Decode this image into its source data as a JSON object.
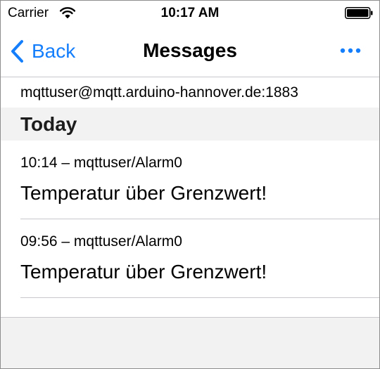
{
  "status_bar": {
    "carrier": "Carrier",
    "time": "10:17 AM",
    "wifi_icon": "wifi-icon",
    "battery_icon": "battery-icon"
  },
  "nav": {
    "back_label": "Back",
    "title": "Messages",
    "more_icon": "more-icon"
  },
  "server": {
    "label": "mqttuser@mqtt.arduino-hannover.de:1883"
  },
  "section": {
    "title": "Today"
  },
  "messages": [
    {
      "meta": "10:14 – mqttuser/Alarm0",
      "text": "Temperatur über Grenzwert!"
    },
    {
      "meta": "09:56 – mqttuser/Alarm0",
      "text": "Temperatur über Grenzwert!"
    }
  ],
  "colors": {
    "accent": "#147efb",
    "separator": "#c8c7cc",
    "group_background": "#f2f2f2"
  }
}
